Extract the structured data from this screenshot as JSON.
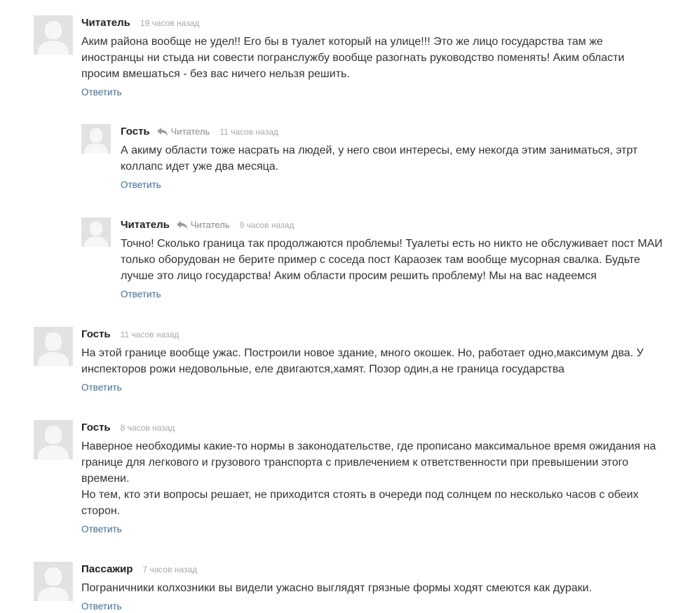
{
  "comments": [
    {
      "author": "Читатель",
      "time": "19 часов назад",
      "paragraphs": [
        "Аким района вообще не удел!! Его бы в туалет который на улице!!! Это же лицо государства там же иностранцы  ни стыда ни совести погранслужбу вообще разогнать руководство поменять! Аким области просим вмешаться - без вас ничего нельзя решить."
      ],
      "reply_label": "Ответить"
    },
    {
      "author": "Гость",
      "reply_to": "Читатель",
      "time": "11 часов назад",
      "paragraphs": [
        "А акиму области тоже насрать на   людей, у него свои интересы, ему некогда этим заниматься, этрт коллапс идет уже два месяца."
      ],
      "reply_label": "Ответить"
    },
    {
      "author": "Читатель",
      "reply_to": "Читатель",
      "time": "9 часов назад",
      "paragraphs": [
        "Точно! Сколько граница так продолжаются проблемы! Туалеты есть но никто не обслуживает пост МАИ только оборудован не берите пример с соседа пост Караозек там вообще мусорная свалка. Будьте лучше это лицо государства! Аким области просим решить проблему! Мы на вас надеемся"
      ],
      "reply_label": "Ответить"
    },
    {
      "author": "Гость",
      "time": "11 часов назад",
      "paragraphs": [
        "На этой границе вообще ужас. Построили новое здание, много окошек. Но, работает одно,максимум два. У инспекторов рожи недовольные, еле двигаются,хамят. Позор один,а не граница государства"
      ],
      "reply_label": "Ответить"
    },
    {
      "author": "Гость",
      "time": "8 часов назад",
      "paragraphs": [
        "Наверное необходимы какие-то нормы в законодательстве, где прописано максимальное время ожидания на границе для легкового и грузового транспорта с привлечением к ответственности при превышении этого времени.",
        "Но тем, кто эти вопросы решает, не приходится стоять в очереди под солнцем по несколько часов с обеих сторон."
      ],
      "reply_label": "Ответить"
    },
    {
      "author": "Пассажир",
      "time": "7 часов назад",
      "paragraphs": [
        "Пограничники колхозники вы видели ужасно выглядят грязные формы ходят смеются как дураки."
      ],
      "reply_label": "Ответить"
    }
  ],
  "icons": {
    "avatar": "default-avatar-icon",
    "reply_to": "reply-arrow-icon"
  },
  "colors": {
    "link": "#3d6d9c",
    "muted": "#a8a8a8",
    "avatar_bg": "#e2e2e2"
  }
}
